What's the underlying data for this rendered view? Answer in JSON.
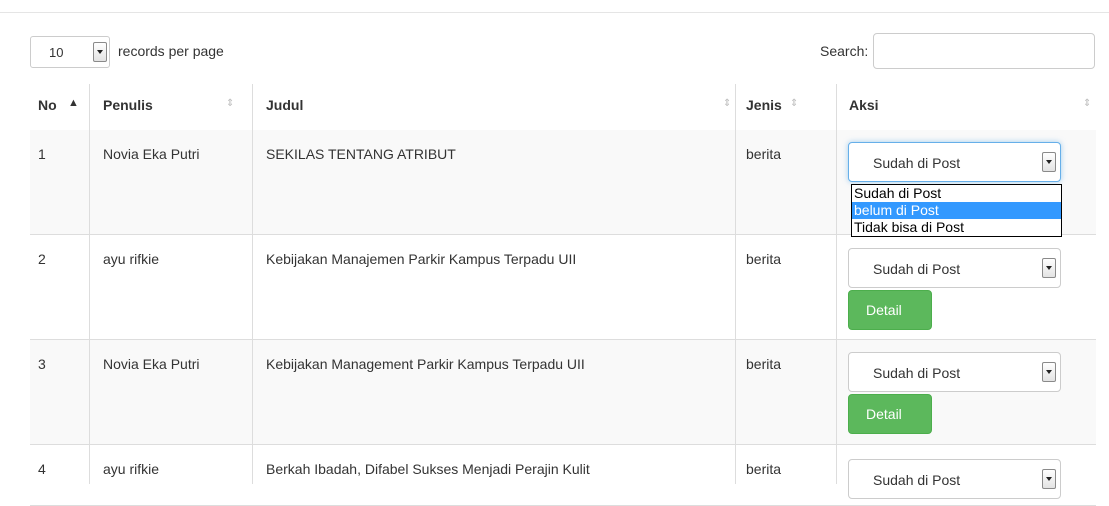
{
  "length_menu": {
    "value": "10",
    "label": "records per page"
  },
  "search": {
    "label": "Search:",
    "value": ""
  },
  "table": {
    "headers": {
      "no": "No",
      "penulis": "Penulis",
      "judul": "Judul",
      "jenis": "Jenis",
      "aksi": "Aksi"
    },
    "sort_icons": {
      "active_asc": "▲",
      "both": "⇕"
    },
    "rows": [
      {
        "no": "1",
        "penulis": "Novia Eka Putri",
        "judul": "SEKILAS TENTANG ATRIBUT",
        "jenis": "berita",
        "status": "Sudah di Post"
      },
      {
        "no": "2",
        "penulis": "ayu rifkie",
        "judul": "Kebijakan Manajemen Parkir Kampus Terpadu UII",
        "jenis": "berita",
        "status": "Sudah di Post",
        "detail_label": "Detail"
      },
      {
        "no": "3",
        "penulis": "Novia Eka Putri",
        "judul": "Kebijakan Management Parkir Kampus Terpadu UII",
        "jenis": "berita",
        "status": "Sudah di Post",
        "detail_label": "Detail"
      },
      {
        "no": "4",
        "penulis": "ayu rifkie",
        "judul": "Berkah Ibadah, Difabel Sukses Menjadi Perajin Kulit",
        "jenis": "berita",
        "status": "Sudah di Post"
      }
    ]
  },
  "status_dropdown": {
    "open": true,
    "options": [
      "Sudah di Post",
      "belum di Post",
      "Tidak bisa di Post"
    ],
    "highlighted": "belum di Post"
  },
  "colors": {
    "detail_button": "#5cb85c",
    "highlight": "#3399ff",
    "border": "#dddddd"
  },
  "icons": {
    "dropdown_arrow": "chevron-down-icon",
    "sort": "sort-icon"
  }
}
